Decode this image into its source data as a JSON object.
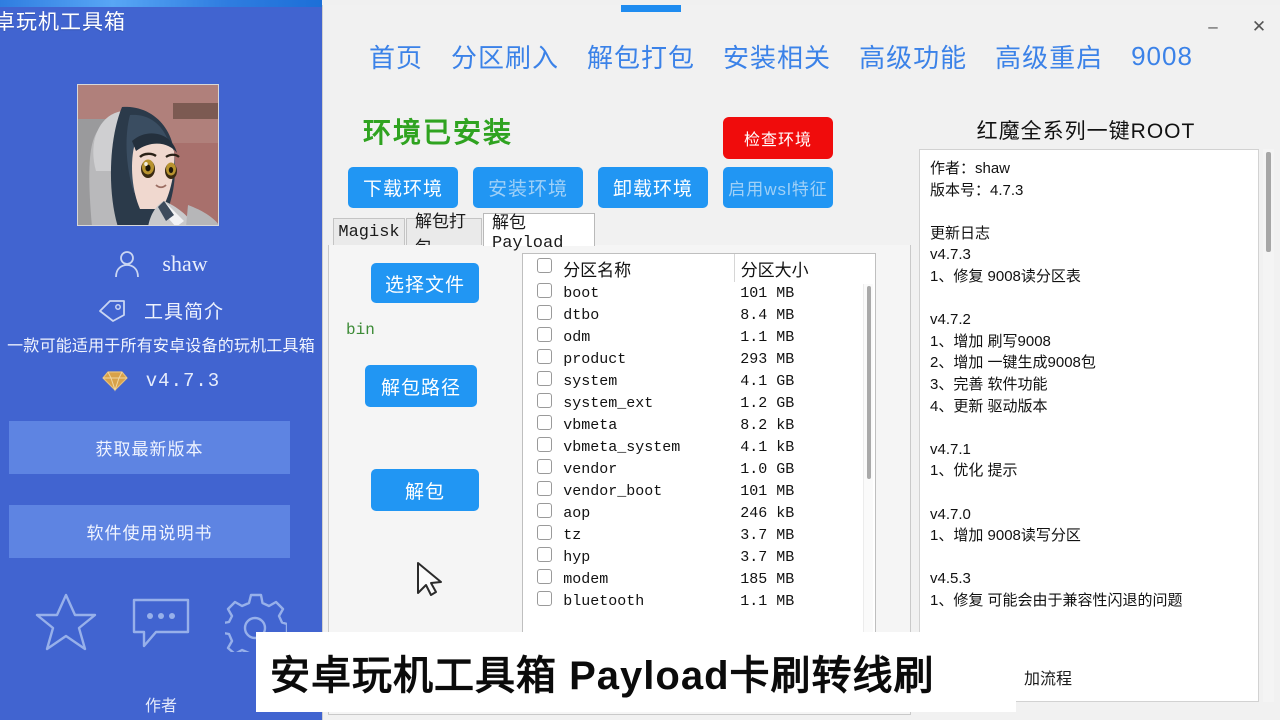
{
  "sidebar": {
    "title": "卓玩机工具箱",
    "user_name": "shaw",
    "intro_label": "工具简介",
    "description": "一款可能适用于所有安卓设备的玩机工具箱",
    "version": "v4.7.3",
    "get_latest_label": "获取最新版本",
    "manual_label": "软件使用说明书",
    "author_label": "作者",
    "icons": [
      "user-icon",
      "tag-icon",
      "diamond-icon",
      "star-icon",
      "chat-icon",
      "gear-icon"
    ],
    "bg_color": "#4164d0",
    "button_color": "#5e84e2"
  },
  "window": {
    "minimize_label": "–",
    "close_label": "✕",
    "accent_color": "#1f8cf0"
  },
  "nav": {
    "items": [
      {
        "label": "首页"
      },
      {
        "label": "分区刷入"
      },
      {
        "label": "解包打包"
      },
      {
        "label": "安装相关"
      },
      {
        "label": "高级功能"
      },
      {
        "label": "高级重启"
      },
      {
        "label": "9008"
      }
    ],
    "color": "#3b82e8"
  },
  "env": {
    "status_text": "环境已安装",
    "status_color": "#2fa320",
    "check_label": "检查环境",
    "check_color": "#f00c0c",
    "download_label": "下载环境",
    "install_label": "安装环境",
    "uninstall_label": "卸载环境",
    "wsl_label": "启用wsl特征",
    "install_disabled": true,
    "wsl_disabled": true
  },
  "tabs": {
    "items": [
      {
        "label": "Magisk",
        "active": false
      },
      {
        "label": "解包打包",
        "active": false
      },
      {
        "label": "解包Payload",
        "active": true
      }
    ]
  },
  "actions": {
    "select_file_label": "选择文件",
    "selected_file": "bin",
    "selected_file_color": "#3d8b37",
    "unpack_path_label": "解包路径",
    "unpack_label": "解包"
  },
  "table": {
    "headers": [
      "分区名称",
      "分区大小"
    ],
    "rows": [
      {
        "name": "boot",
        "size": "101 MB",
        "checked": false
      },
      {
        "name": "dtbo",
        "size": "8.4 MB",
        "checked": false
      },
      {
        "name": "odm",
        "size": "1.1 MB",
        "checked": false
      },
      {
        "name": "product",
        "size": "293 MB",
        "checked": false
      },
      {
        "name": "system",
        "size": "4.1 GB",
        "checked": false
      },
      {
        "name": "system_ext",
        "size": "1.2 GB",
        "checked": false
      },
      {
        "name": "vbmeta",
        "size": "8.2 kB",
        "checked": false
      },
      {
        "name": "vbmeta_system",
        "size": "4.1 kB",
        "checked": false
      },
      {
        "name": "vendor",
        "size": "1.0 GB",
        "checked": false
      },
      {
        "name": "vendor_boot",
        "size": "101 MB",
        "checked": false
      },
      {
        "name": "aop",
        "size": "246 kB",
        "checked": false
      },
      {
        "name": "tz",
        "size": "3.7 MB",
        "checked": false
      },
      {
        "name": "hyp",
        "size": "3.7 MB",
        "checked": false
      },
      {
        "name": "modem",
        "size": "185 MB",
        "checked": false
      },
      {
        "name": "bluetooth",
        "size": "1.1 MB",
        "checked": false
      }
    ]
  },
  "info": {
    "title": "红魔全系列一键ROOT",
    "body": "作者：shaw\n版本号：4.7.3\n\n更新日志\nv4.7.3\n1、修复 9008读分区表\n\nv4.7.2\n1、增加 刷写9008\n2、增加 一键生成9008包\n3、完善 软件功能\n4、更新 驱动版本\n\nv4.7.1\n1、优化 提示\n\nv4.7.0\n1、增加 9008读写分区\n\nv4.5.3\n1、修复 可能会由于兼容性闪退的问题"
  },
  "caption": {
    "text": "安卓玩机工具箱 Payload卡刷转线刷"
  },
  "background_text": {
    "partial": "加流程"
  }
}
